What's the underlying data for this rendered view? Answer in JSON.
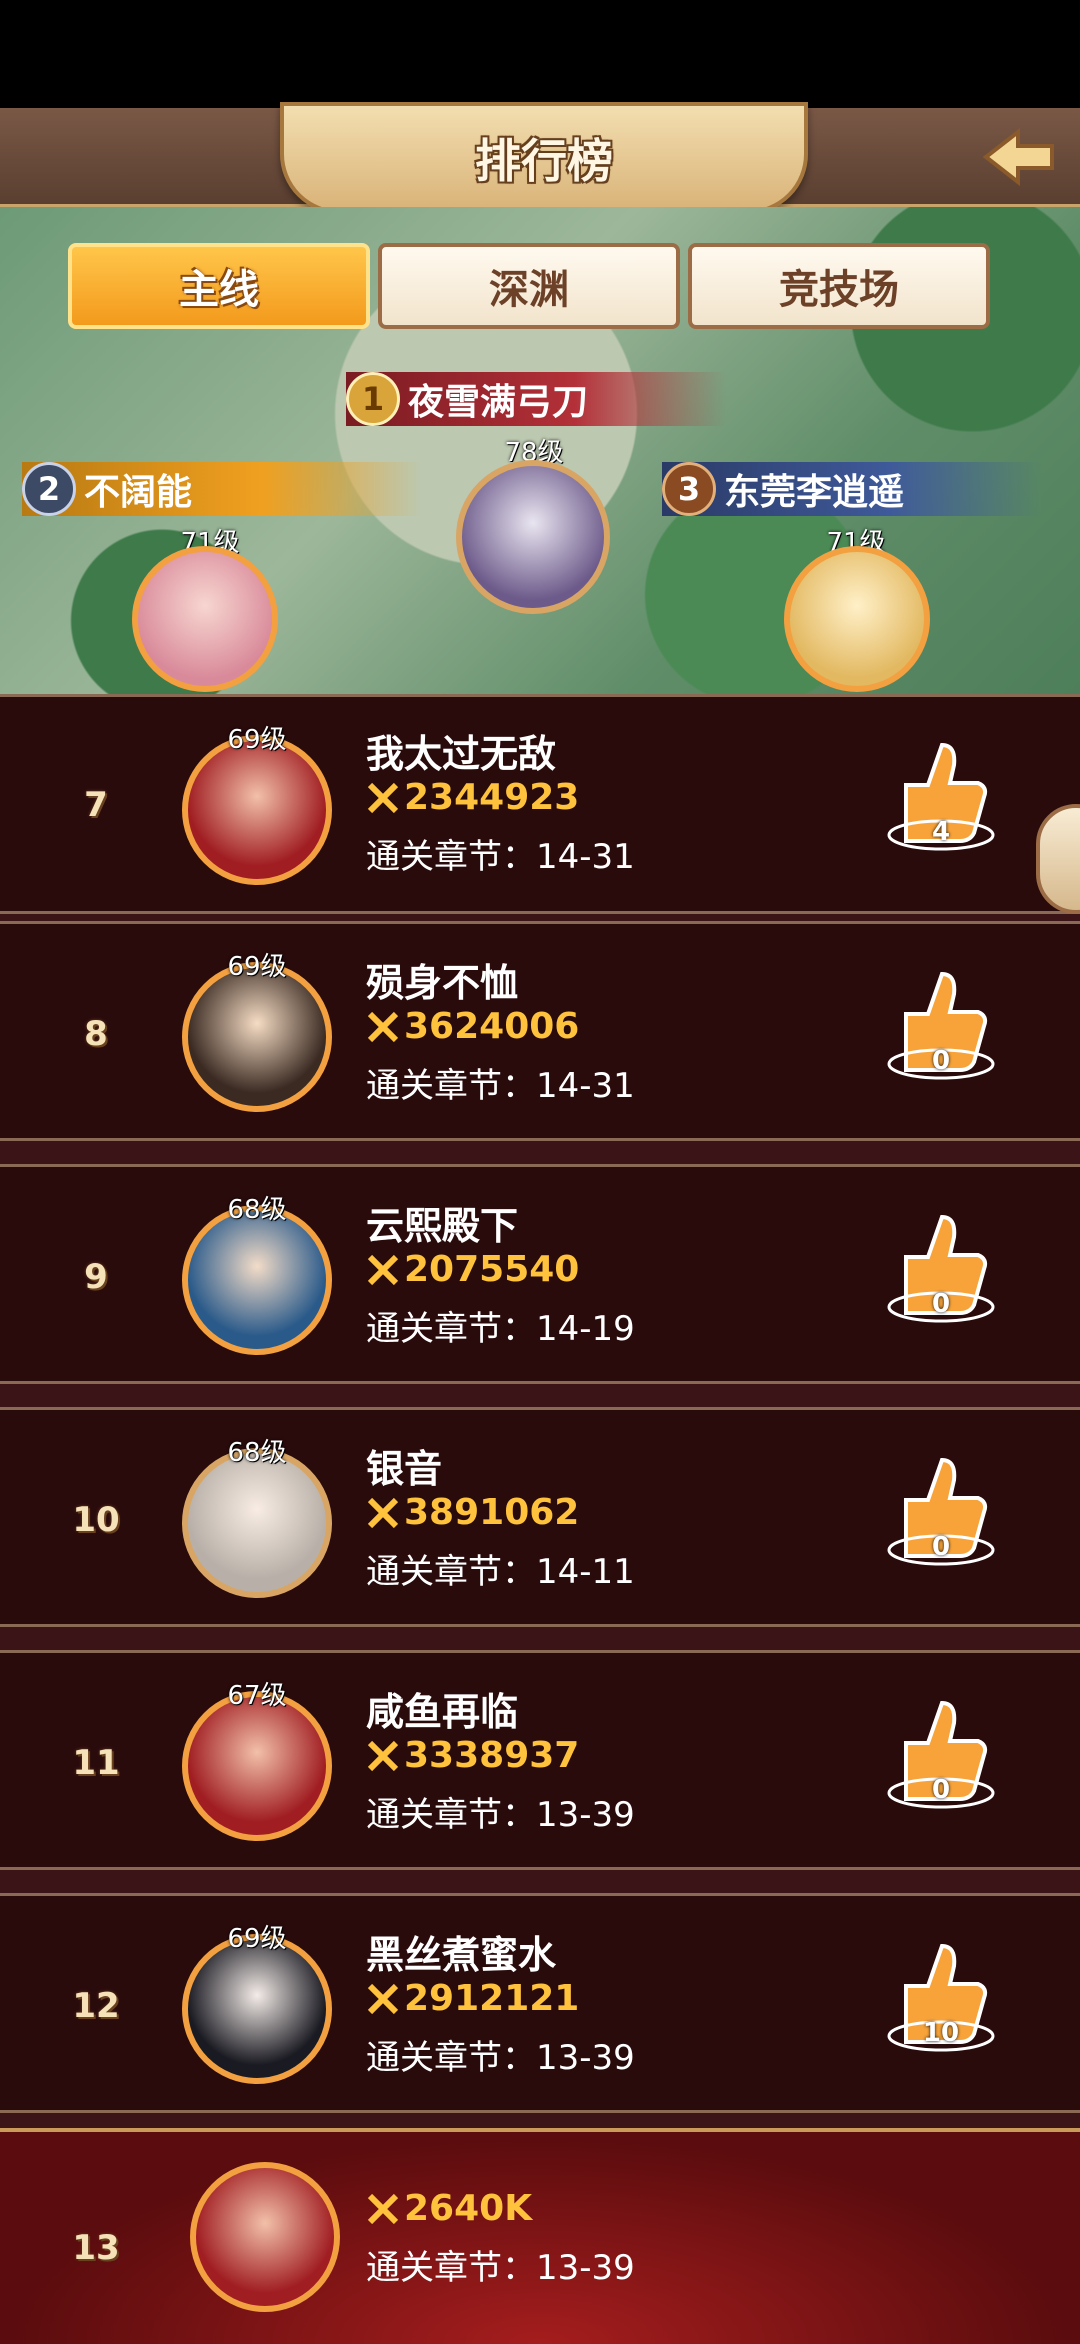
{
  "header": {
    "title": "排行榜"
  },
  "tabs": [
    {
      "label": "主线",
      "active": true
    },
    {
      "label": "深渊",
      "active": false
    },
    {
      "label": "竞技场",
      "active": false
    }
  ],
  "podium": [
    {
      "rank": "1",
      "name": "夜雪满弓刀",
      "level": "78级"
    },
    {
      "rank": "2",
      "name": "不阔能",
      "level": "71级"
    },
    {
      "rank": "3",
      "name": "东莞李逍遥",
      "level": "71级"
    }
  ],
  "rows": [
    {
      "rank": "7",
      "level": "69级",
      "name": "我太过无敌",
      "power": "2344923",
      "chapter": "通关章节：14-31",
      "likes": "4"
    },
    {
      "rank": "8",
      "level": "69级",
      "name": "殒身不恤",
      "power": "3624006",
      "chapter": "通关章节：14-31",
      "likes": "0"
    },
    {
      "rank": "9",
      "level": "68级",
      "name": "云熙殿下",
      "power": "2075540",
      "chapter": "通关章节：14-19",
      "likes": "0"
    },
    {
      "rank": "10",
      "level": "68级",
      "name": "银音",
      "power": "3891062",
      "chapter": "通关章节：14-11",
      "likes": "0"
    },
    {
      "rank": "11",
      "level": "67级",
      "name": "咸鱼再临",
      "power": "3338937",
      "chapter": "通关章节：13-39",
      "likes": "0"
    },
    {
      "rank": "12",
      "level": "69级",
      "name": "黑丝煮蜜水",
      "power": "2912121",
      "chapter": "通关章节：13-39",
      "likes": "10"
    }
  ],
  "self": {
    "rank": "13",
    "power": "2640K",
    "chapter": "通关章节：13-39"
  },
  "colors": {
    "accent": "#f39a1c",
    "power": "#ffc23c",
    "row_bg": "#2a0b0c"
  },
  "icons": {
    "back": "back-arrow-icon",
    "power": "crossed-swords-icon",
    "like": "thumbs-up-icon"
  }
}
